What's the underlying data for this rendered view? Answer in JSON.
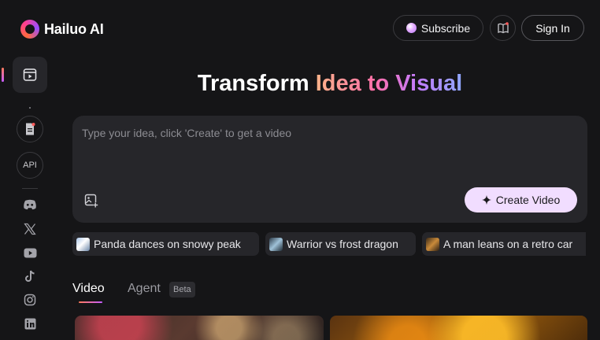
{
  "header": {
    "brand": "Hailuo AI",
    "subscribe_label": "Subscribe",
    "signin_label": "Sign In"
  },
  "sidebar": {
    "items": [
      {
        "icon": "video-icon",
        "active": true
      },
      {
        "icon": "document-icon"
      },
      {
        "label": "API"
      },
      {
        "icon": "discord-icon"
      },
      {
        "icon": "x-icon"
      },
      {
        "icon": "youtube-icon"
      },
      {
        "icon": "tiktok-icon"
      },
      {
        "icon": "instagram-icon"
      },
      {
        "icon": "linkedin-icon"
      }
    ]
  },
  "hero": {
    "title_plain": "Transform ",
    "title_gradient": "Idea to Visual"
  },
  "prompt": {
    "placeholder": "Type your idea, click 'Create' to get a video",
    "create_label": "Create Video"
  },
  "suggestions": [
    {
      "label": "Panda dances on snowy peak"
    },
    {
      "label": "Warrior vs frost dragon"
    },
    {
      "label": "A man leans on a retro car"
    }
  ],
  "tabs": {
    "video_label": "Video",
    "agent_label": "Agent",
    "beta_label": "Beta"
  },
  "colors": {
    "background": "#151517",
    "panel": "#26262a",
    "create_button": "#f1ddff",
    "accent_gradient": [
      "#ff7a59",
      "#c65cff"
    ]
  }
}
